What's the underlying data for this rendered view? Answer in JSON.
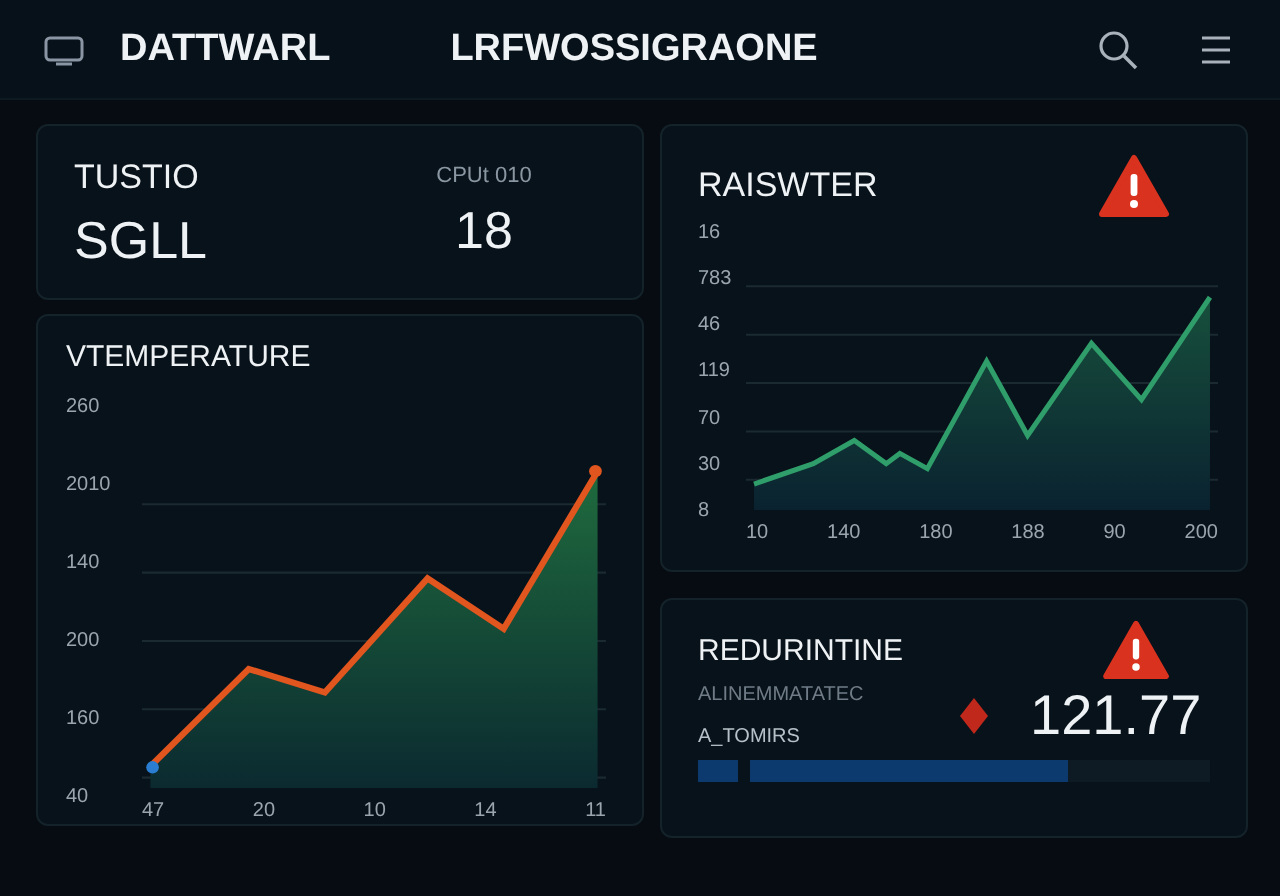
{
  "header": {
    "brand": "DATTWARL",
    "title": "LRFWOSSIGRAONE"
  },
  "stat_card": {
    "label": "TUSTIO",
    "value": "SGLL",
    "metric_label": "CPUt 010",
    "metric_value": "18"
  },
  "temperature_card": {
    "title": "VTEMPERATURE",
    "y_labels": [
      "260",
      "2010",
      "140",
      "200",
      "160",
      "40"
    ],
    "x_labels": [
      "47",
      "20",
      "10",
      "14",
      "11"
    ]
  },
  "alert_chart_card": {
    "title": "RAISWTER",
    "alert": true,
    "y_labels": [
      "16",
      "783",
      "46",
      "119",
      "70",
      "30",
      "8"
    ],
    "x_labels": [
      "10",
      "140",
      "180",
      "188",
      "90",
      "200"
    ]
  },
  "status_card": {
    "title": "REDURINTINE",
    "alert": true,
    "caption": "ALINEMMATATEC",
    "sublabel": "A_TOMIRS",
    "value": "121.77",
    "level": 0.69
  }
}
